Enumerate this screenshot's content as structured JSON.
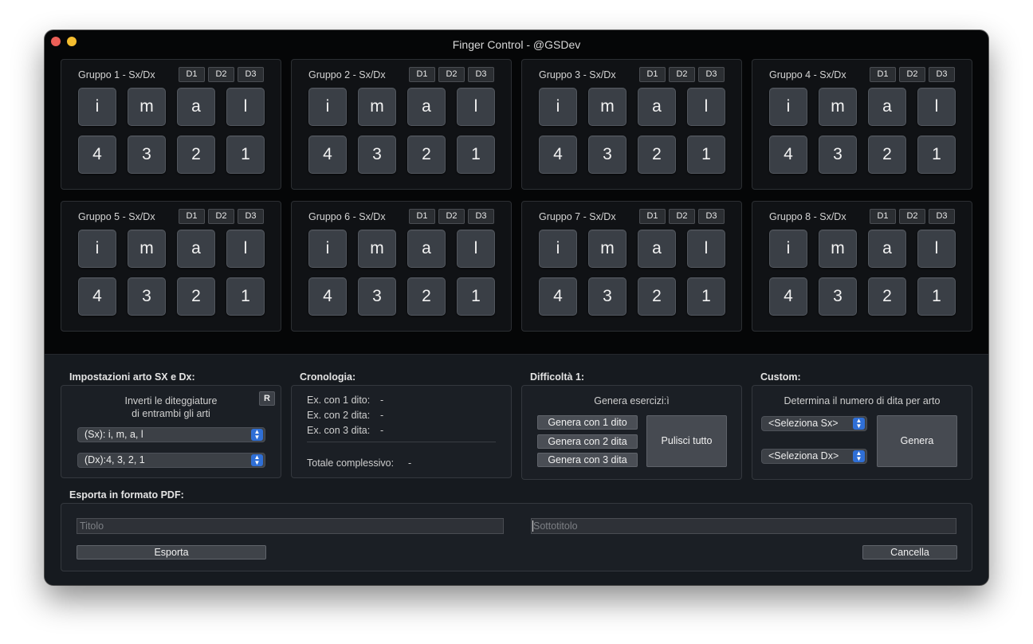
{
  "window": {
    "title": "Finger Control - @GSDev"
  },
  "groups": [
    {
      "title": "Gruppo 1 - Sx/Dx",
      "d_buttons": [
        "D1",
        "D2",
        "D3"
      ],
      "top_row": [
        "i",
        "m",
        "a",
        "l"
      ],
      "bottom_row": [
        "4",
        "3",
        "2",
        "1"
      ]
    },
    {
      "title": "Gruppo 2 - Sx/Dx",
      "d_buttons": [
        "D1",
        "D2",
        "D3"
      ],
      "top_row": [
        "i",
        "m",
        "a",
        "l"
      ],
      "bottom_row": [
        "4",
        "3",
        "2",
        "1"
      ]
    },
    {
      "title": "Gruppo 3 - Sx/Dx",
      "d_buttons": [
        "D1",
        "D2",
        "D3"
      ],
      "top_row": [
        "i",
        "m",
        "a",
        "l"
      ],
      "bottom_row": [
        "4",
        "3",
        "2",
        "1"
      ]
    },
    {
      "title": "Gruppo 4 - Sx/Dx",
      "d_buttons": [
        "D1",
        "D2",
        "D3"
      ],
      "top_row": [
        "i",
        "m",
        "a",
        "l"
      ],
      "bottom_row": [
        "4",
        "3",
        "2",
        "1"
      ]
    },
    {
      "title": "Gruppo 5 - Sx/Dx",
      "d_buttons": [
        "D1",
        "D2",
        "D3"
      ],
      "top_row": [
        "i",
        "m",
        "a",
        "l"
      ],
      "bottom_row": [
        "4",
        "3",
        "2",
        "1"
      ]
    },
    {
      "title": "Gruppo 6 - Sx/Dx",
      "d_buttons": [
        "D1",
        "D2",
        "D3"
      ],
      "top_row": [
        "i",
        "m",
        "a",
        "l"
      ],
      "bottom_row": [
        "4",
        "3",
        "2",
        "1"
      ]
    },
    {
      "title": "Gruppo 7 - Sx/Dx",
      "d_buttons": [
        "D1",
        "D2",
        "D3"
      ],
      "top_row": [
        "i",
        "m",
        "a",
        "l"
      ],
      "bottom_row": [
        "4",
        "3",
        "2",
        "1"
      ]
    },
    {
      "title": "Gruppo 8 - Sx/Dx",
      "d_buttons": [
        "D1",
        "D2",
        "D3"
      ],
      "top_row": [
        "i",
        "m",
        "a",
        "l"
      ],
      "bottom_row": [
        "4",
        "3",
        "2",
        "1"
      ]
    }
  ],
  "settings": {
    "label": "Impostazioni arto SX e Dx:",
    "invert_text_1": "Inverti le diteggiature",
    "invert_text_2": "di entrambi gli arti",
    "reset_button": "R",
    "sx_select": "(Sx): i, m, a, l",
    "dx_select": "(Dx):4, 3, 2, 1"
  },
  "history": {
    "label": "Cronologia:",
    "rows": [
      {
        "label": "Ex. con 1 dito:",
        "value": "-"
      },
      {
        "label": "Ex. con 2 dita:",
        "value": "-"
      },
      {
        "label": "Ex. con 3 dita:",
        "value": "-"
      }
    ],
    "total_label": "Totale complessivo:",
    "total_value": "-"
  },
  "difficulty": {
    "label": "Difficoltà 1:",
    "subtitle": "Genera esercizi:ì",
    "buttons": [
      "Genera con 1 dito",
      "Genera con 2 dita",
      "Genera con 3 dita"
    ],
    "clear_button": "Pulisci tutto"
  },
  "custom": {
    "label": "Custom:",
    "subtitle": "Determina il numero di dita per arto",
    "sx_select": "<Seleziona Sx>",
    "dx_select": "<Seleziona Dx>",
    "generate_button": "Genera"
  },
  "export": {
    "label": "Esporta in formato PDF:",
    "title_placeholder": "Titolo",
    "subtitle_placeholder": "Sottotitolo",
    "export_button": "Esporta",
    "cancel_button": "Cancella"
  },
  "colors": {
    "window_bg": "#050607",
    "bottom_bg": "#161a1f",
    "select_accent": "#2f6fd6",
    "close": "#ec5f57",
    "minimize": "#f4bd2f"
  }
}
